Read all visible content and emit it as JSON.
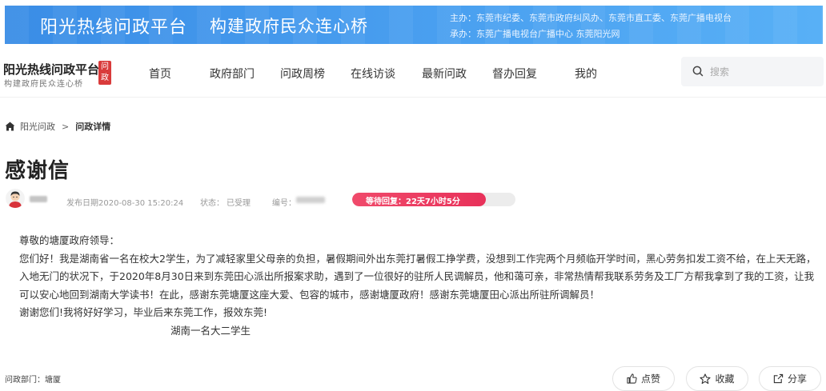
{
  "banner": {
    "title": "阳光热线问政平台",
    "slogan": "构建政府民众连心桥",
    "host_line": "主办：东莞市纪委、东莞市政府纠风办、东莞市直工委、东莞广播电视台",
    "organizer_line": "承办：东莞广播电视台广播中心  东莞阳光网"
  },
  "logo": {
    "title": "阳光热线问政平台",
    "subtitle": "构建政府民众连心桥",
    "badge": "问政"
  },
  "nav": {
    "items": [
      "首页",
      "政府部门",
      "问政周榜",
      "在线访谈",
      "最新问政",
      "督办回复",
      "我的"
    ]
  },
  "search": {
    "placeholder": "搜索",
    "icon": "search-icon"
  },
  "breadcrumb": {
    "home": "阳光问政",
    "separator": ">",
    "current": "问政详情",
    "icon": "home-icon"
  },
  "post": {
    "title": "感谢信",
    "publish_date": "发布日期2020-08-30 15:20:24",
    "status_label": "状态：",
    "status_value": "已受理",
    "number_label": "编号：",
    "wait_text": "等待回复：22天7小时5分",
    "wait_progress": 0.82,
    "wait_color": "#e8315a"
  },
  "letter": {
    "greeting": "尊敬的塘厦政府领导：",
    "paragraph": "您们好！我是湖南省一名在校大2学生，为了减轻家里父母亲的负担，暑假期间外出东莞打暑假工挣学费，没想到工作完两个月频临开学时间，黑心劳务扣发工资不给，在上天无路，入地无门的状况下，于2020年8月30日来到东莞田心派出所报案求助，遇到了一位很好的驻所人民调解员，他和蔼可亲，非常热情帮我联系劳务及工厂方帮我拿到了我的工资，让我可以安心地回到湖南大学读书！在此，感谢东莞塘厦这座大爱、包容的城市，感谢塘厦政府！感谢东莞塘厦田心派出所驻所调解员！",
    "closing": "谢谢您们!我将好好学习，毕业后来东莞工作，报效东莞!",
    "signature": "湖南一名大二学生"
  },
  "footer": {
    "dept_label": "问政部门：",
    "dept_value": "塘厦",
    "like_label": "点赞",
    "favorite_label": "收藏",
    "share_label": "分享"
  }
}
